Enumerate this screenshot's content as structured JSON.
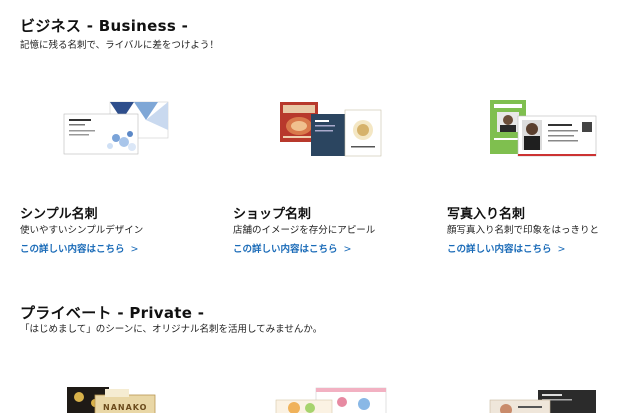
{
  "business": {
    "title": "ビジネス - Business -",
    "subtitle": "記憶に残る名刺で、ライバルに差をつけよう！",
    "cards": [
      {
        "title": "シンプル名刺",
        "desc": "使いやすいシンプルデザイン",
        "link": "この詳しい内容はこちら",
        "icon": "chevron-right-icon"
      },
      {
        "title": "ショップ名刺",
        "desc": "店舗のイメージを存分にアピール",
        "link": "この詳しい内容はこちら",
        "icon": "chevron-right-icon"
      },
      {
        "title": "写真入り名刺",
        "desc": "顔写真入り名刺で印象をはっきりと",
        "link": "この詳しい内容はこちら",
        "icon": "chevron-right-icon"
      }
    ]
  },
  "private": {
    "title": "プライベート - Private -",
    "subtitle": "「はじめまして」のシーンに、オリジナル名刺を活用してみませんか。",
    "sample_text": "NANAKO"
  },
  "colors": {
    "link": "#1a6bb8",
    "text": "#111111"
  }
}
